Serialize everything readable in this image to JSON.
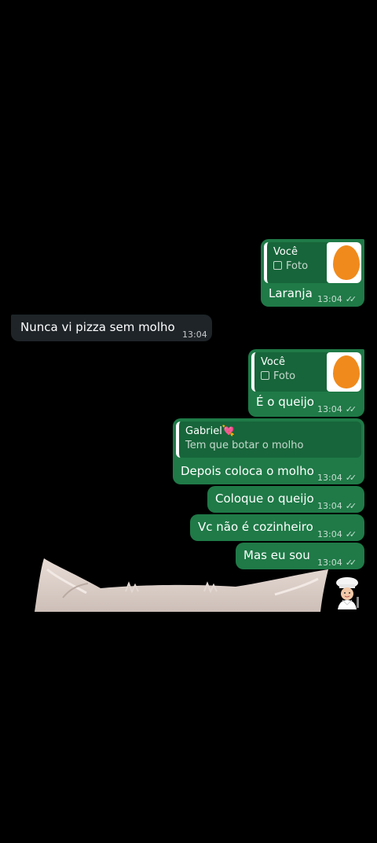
{
  "colors": {
    "outgoing_bubble": "#1f7a47",
    "incoming_bubble": "#1e2428",
    "quote_bg": "#17653a",
    "thumbnail_orange": "#f08a1c",
    "background": "#000000"
  },
  "messages": [
    {
      "direction": "outgoing",
      "reply_name": "Você",
      "reply_sub": "Foto",
      "text": "Laranja",
      "time": "13:04",
      "ticks": "✓✓"
    },
    {
      "direction": "incoming",
      "text": "Nunca vi pizza sem molho",
      "time": "13:04"
    },
    {
      "direction": "outgoing",
      "reply_name": "Você",
      "reply_sub": "Foto",
      "text": "É o queijo",
      "time": "13:04",
      "ticks": "✓✓"
    },
    {
      "direction": "outgoing",
      "reply_name": "Gabriel💘",
      "reply_sub": "Tem que botar o molho",
      "text": "Depois coloca o molho",
      "time": "13:04",
      "ticks": "✓✓"
    },
    {
      "direction": "outgoing",
      "text": "Coloque o queijo",
      "time": "13:04",
      "ticks": "✓✓"
    },
    {
      "direction": "outgoing",
      "text": "Vc não é cozinheiro",
      "time": "13:04",
      "ticks": "✓✓"
    },
    {
      "direction": "outgoing",
      "text": "Mas eu sou",
      "time": "13:04",
      "ticks": "✓✓"
    }
  ],
  "icons": {
    "photo": "photo-icon",
    "read_receipt": "double-check-icon",
    "sticker": "chef-sticker-icon",
    "cat": "cat-ears-image"
  }
}
